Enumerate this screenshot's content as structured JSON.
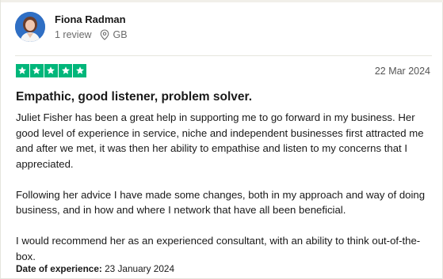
{
  "reviewer": {
    "name": "Fiona Radman",
    "review_count": "1 review",
    "country": "GB",
    "avatar_icon": "user-photo"
  },
  "rating": {
    "stars": 5,
    "max": 5,
    "color": "#00b67a",
    "star_icon": "star-icon"
  },
  "review": {
    "date": "22 Mar 2024",
    "title": "Empathic, good listener, problem solver.",
    "paragraphs": [
      "Juliet Fisher has been a great help in supporting me to go forward in my business. Her good level of experience in service, niche and independent businesses first attracted me and after we met, it was then her ability to empathise and listen to my concerns that I appreciated.",
      "Following her advice I have made some changes, both in my approach and way of doing business, and in how and where I network that have all been beneficial.",
      "I would recommend her as an experienced consultant, with an ability to think out-of-the-box."
    ],
    "experience_label": "Date of experience:",
    "experience_date": "23 January 2024"
  }
}
